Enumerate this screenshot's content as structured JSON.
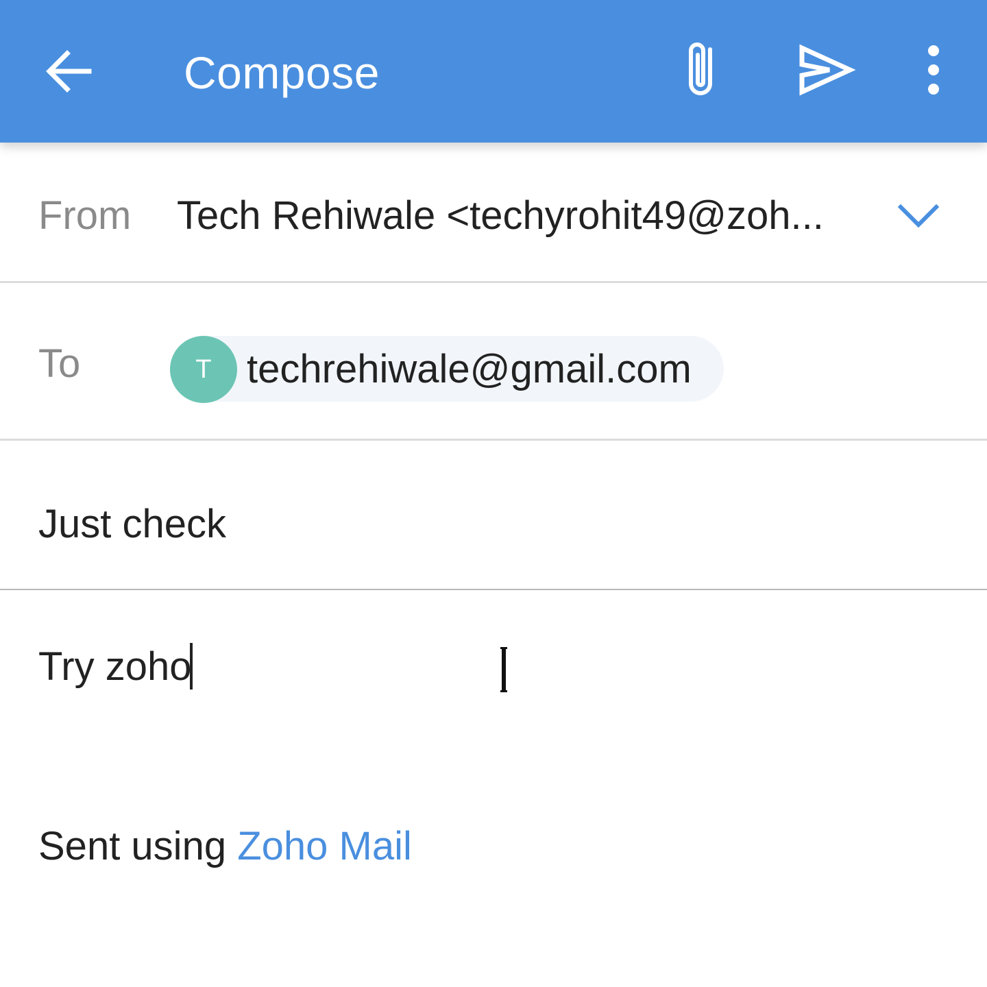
{
  "appbar": {
    "title": "Compose",
    "icons": [
      "back-arrow-icon",
      "attachment-icon",
      "send-icon",
      "more-vertical-icon"
    ],
    "color": "#4a8fdf"
  },
  "from": {
    "label": "From",
    "value": "Tech Rehiwale <techyrohit49@zoh..."
  },
  "to": {
    "label": "To",
    "recipient": {
      "initial": "T",
      "email": "techrehiwale@gmail.com",
      "avatar_color": "#6cc5b4"
    }
  },
  "subject": {
    "value": "Just check"
  },
  "body": {
    "text": "Try zoho",
    "signature_prefix": "Sent using ",
    "signature_link": "Zoho Mail",
    "link_color": "#4a8fdf"
  }
}
